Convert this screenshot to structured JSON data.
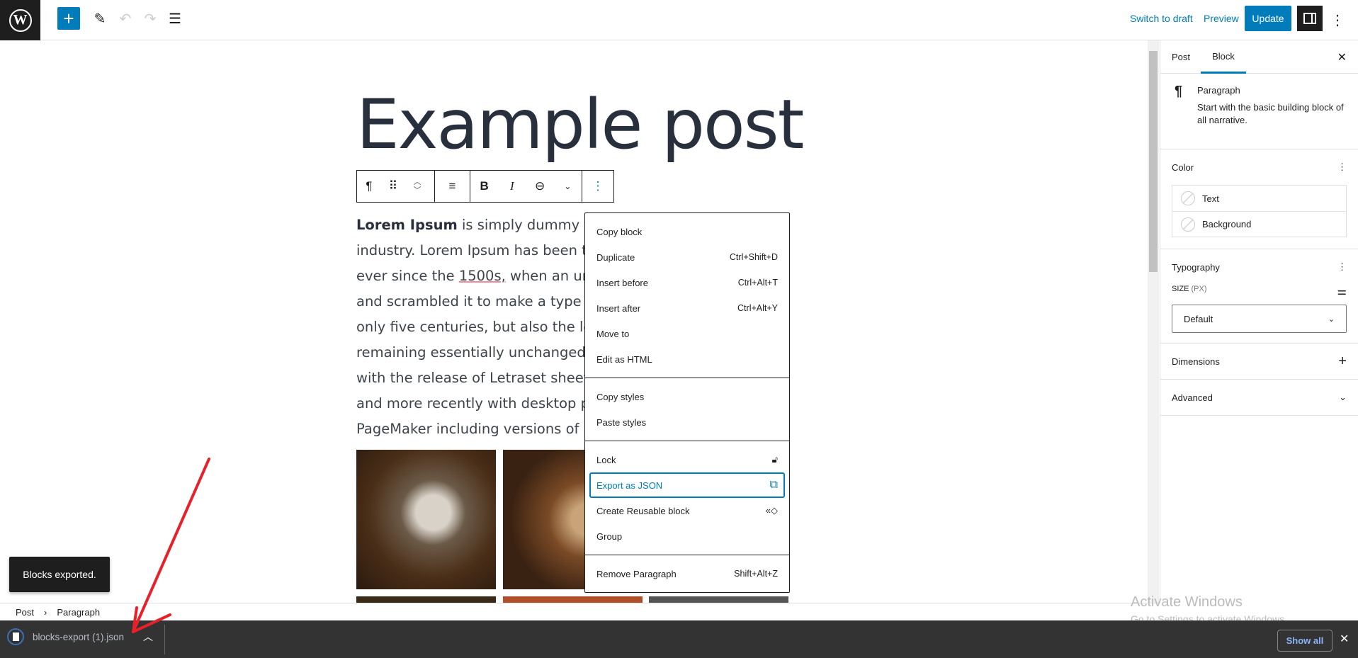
{
  "topbar": {
    "logo": "WordPress",
    "add_icon": "plus-icon",
    "tools_icon": "pencil-icon",
    "undo_icon": "undo-icon",
    "redo_icon": "redo-icon",
    "list_view_icon": "list-view-icon",
    "switch_to_draft": "Switch to draft",
    "preview": "Preview",
    "update": "Update",
    "settings_icon": "sidebar-toggle-icon",
    "options_icon": "more-vertical-icon"
  },
  "editor": {
    "title": "Example post",
    "block_toolbar": {
      "block_type_icon": "paragraph-icon",
      "drag_icon": "drag-handle-icon",
      "move_up": "chevron-up-icon",
      "move_down": "chevron-down-icon",
      "align": "align-left-icon",
      "bold": "B",
      "italic": "I",
      "link": "link-icon",
      "more": "chevron-down-icon",
      "options": "more-vertical-icon"
    },
    "paragraph": {
      "bold_lead": "Lorem Ipsum",
      "lines": [
        " is simply dummy text c",
        "industry. Lorem Ipsum has been the",
        "ever since the ",
        "and scrambled it to make a type spe",
        "only five centuries, but also the leap",
        "remaining essentially unchanged. It w",
        "with the release of Letraset sheets co",
        "and more recently with desktop pub",
        "PageMaker including versions of Lor"
      ],
      "underlined": "1500s,",
      "line3_rest": " when an unkno"
    }
  },
  "block_menu": {
    "sections": [
      [
        {
          "label": "Copy block",
          "shortcut": ""
        },
        {
          "label": "Duplicate",
          "shortcut": "Ctrl+Shift+D"
        },
        {
          "label": "Insert before",
          "shortcut": "Ctrl+Alt+T"
        },
        {
          "label": "Insert after",
          "shortcut": "Ctrl+Alt+Y"
        },
        {
          "label": "Move to",
          "shortcut": ""
        },
        {
          "label": "Edit as HTML",
          "shortcut": ""
        }
      ],
      [
        {
          "label": "Copy styles",
          "shortcut": ""
        },
        {
          "label": "Paste styles",
          "shortcut": ""
        }
      ],
      [
        {
          "label": "Lock",
          "icon": "lock-icon"
        },
        {
          "label": "Export as JSON",
          "icon": "external-link-icon",
          "selected": true
        },
        {
          "label": "Create Reusable block",
          "icon": "reusable-block-icon"
        },
        {
          "label": "Group"
        }
      ],
      [
        {
          "label": "Remove Paragraph",
          "shortcut": "Shift+Alt+Z"
        }
      ]
    ]
  },
  "toast": "Blocks exported.",
  "breadcrumb": [
    "Post",
    "Paragraph"
  ],
  "sidebar": {
    "tabs": [
      "Post",
      "Block"
    ],
    "active_tab": "Block",
    "close_icon": "close-icon",
    "block_card": {
      "name": "Paragraph",
      "description": "Start with the basic building block of all narrative."
    },
    "color": {
      "title": "Color",
      "items": [
        "Text",
        "Background"
      ]
    },
    "typography": {
      "title": "Typography",
      "size_label": "SIZE",
      "size_unit": "(PX)",
      "size_value": "Default"
    },
    "dimensions": "Dimensions",
    "advanced": "Advanced"
  },
  "download_bar": {
    "file": "blocks-export (1).json",
    "show_all": "Show all"
  },
  "watermark": {
    "line1": "Activate Windows",
    "line2": "Go to Settings to activate Windows."
  },
  "colors": {
    "accent": "#007cba",
    "dark": "#1e1e1e",
    "download_bar": "#333333",
    "annotation_arrow": "#e8202a"
  }
}
